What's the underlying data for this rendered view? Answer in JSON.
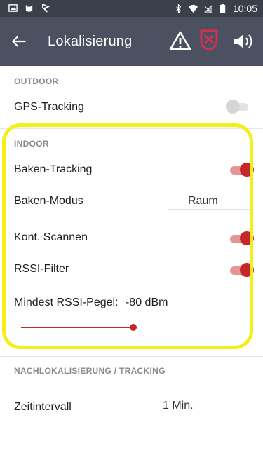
{
  "status_bar": {
    "time": "10:05",
    "icons": [
      "image-icon",
      "cat-icon",
      "flag-icon",
      "bluetooth-icon",
      "wifi-icon",
      "signal-icon",
      "battery-icon"
    ]
  },
  "app_bar": {
    "title": "Lokalisierung",
    "back_icon": "arrow-left-icon",
    "action_icons": [
      "warning-icon",
      "shield-alert-icon",
      "volume-icon"
    ],
    "background": "#4b5160"
  },
  "sections": {
    "outdoor": {
      "header": "OUTDOOR",
      "gps_tracking": {
        "label": "GPS-Tracking",
        "enabled": false
      }
    },
    "indoor": {
      "header": "INDOOR",
      "baken_tracking": {
        "label": "Baken-Tracking",
        "enabled": true
      },
      "baken_modus": {
        "label": "Baken-Modus",
        "value": "Raum"
      },
      "kont_scannen": {
        "label": "Kont. Scannen",
        "enabled": true
      },
      "rssi_filter": {
        "label": "RSSI-Filter",
        "enabled": true
      },
      "mindest_rssi": {
        "label": "Mindest RSSI-Pegel:",
        "value": "-80 dBm",
        "slider_level": 1.0
      }
    },
    "nachlokalisierung": {
      "header": "NACHLOKALISIERUNG / TRACKING",
      "zeitintervall": {
        "label": "Zeitintervall",
        "value": "1 Min."
      }
    }
  },
  "colors": {
    "accent": "#c62828",
    "highlight": "#f5ee1a",
    "status_bar": "#3a3f4a"
  }
}
